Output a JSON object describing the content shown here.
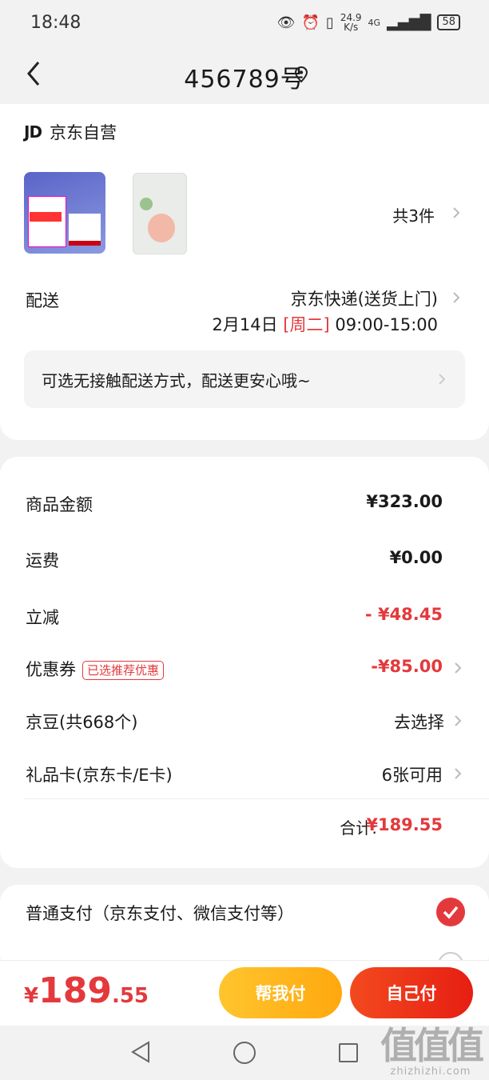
{
  "status_bar": {
    "time": "18:48",
    "speed_value": "24.9",
    "speed_unit": "K/s",
    "network": "4G",
    "battery": "58"
  },
  "nav": {
    "title": "456789号"
  },
  "shop": {
    "logo": "JD",
    "name": "京东自营"
  },
  "products": {
    "count_label": "共3件"
  },
  "delivery": {
    "label": "配送",
    "method": "京东快递(送货上门)",
    "date": "2月14日",
    "weekday": "[周二]",
    "time_range": "09:00-15:00",
    "contactless_tip": "可选无接触配送方式，配送更安心哦~"
  },
  "summary": {
    "goods_label": "商品金额",
    "goods_value": "¥323.00",
    "shipping_label": "运费",
    "shipping_value": "¥0.00",
    "discount_label": "立减",
    "discount_value": "- ¥48.45",
    "coupon_label": "优惠券",
    "coupon_badge": "已选推荐优惠",
    "coupon_value": "-¥85.00",
    "beans_label": "京豆(共668个)",
    "beans_value": "去选择",
    "giftcard_label": "礼品卡(京东卡/E卡)",
    "giftcard_value": "6张可用",
    "total_label": "合计:",
    "total_value": "¥189.55"
  },
  "payment": {
    "option1_label": "普通支付（京东支付、微信支付等）"
  },
  "bottom": {
    "currency": "¥",
    "price_int": "189",
    "price_dec": ".55",
    "help_pay_label": "帮我付",
    "self_pay_label": "自己付"
  },
  "watermark": {
    "glyph": "值值值",
    "url": "zhizhizhi.com"
  },
  "colors": {
    "accent_red": "#e4393c",
    "yellow_button": "#ffb81c",
    "red_button": "#ec2b17"
  }
}
